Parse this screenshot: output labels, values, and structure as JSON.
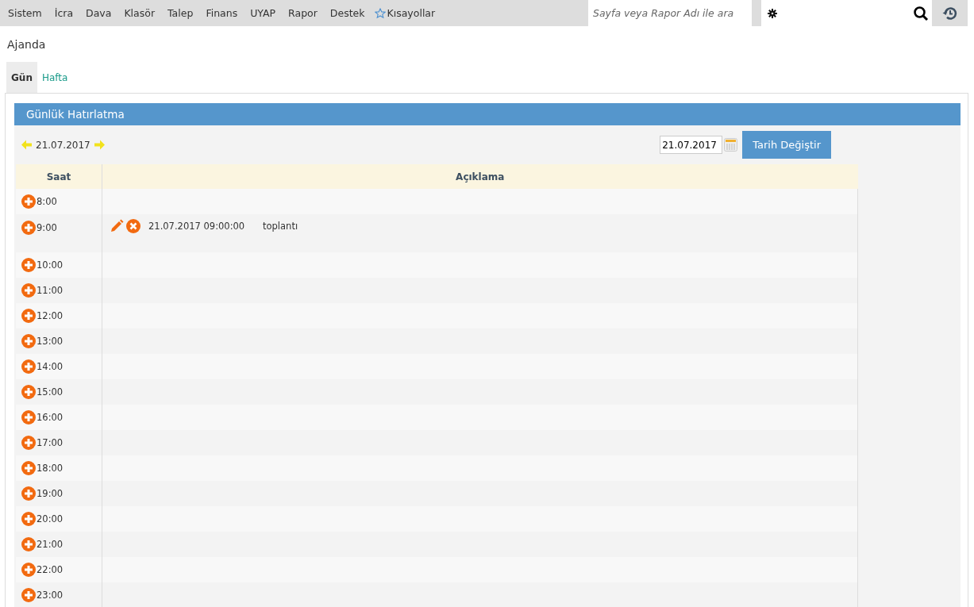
{
  "menu": [
    {
      "label": "Sistem"
    },
    {
      "label": "İcra"
    },
    {
      "label": "Dava"
    },
    {
      "label": "Klasör"
    },
    {
      "label": "Talep"
    },
    {
      "label": "Finans"
    },
    {
      "label": "UYAP"
    },
    {
      "label": "Rapor"
    },
    {
      "label": "Destek"
    }
  ],
  "shortcuts": {
    "label": "Kısayollar"
  },
  "search": {
    "placeholder": "Sayfa veya Rapor Adı ile ara"
  },
  "page_title": "Ajanda",
  "tabs": [
    {
      "label": "Gün",
      "selected": true
    },
    {
      "label": "Hafta",
      "selected": false
    }
  ],
  "panel": {
    "title": "Günlük Hatırlatma",
    "current_date": "21.07.2017",
    "date_field": {
      "value": "21.07.2017"
    },
    "change_button": "Tarih Değiştir",
    "columns": [
      "Saat",
      "Açıklama"
    ],
    "rows": [
      {
        "time": "8:00",
        "entries": []
      },
      {
        "time": "9:00",
        "entries": [
          {
            "datetime": "21.07.2017 09:00:00",
            "description": "toplantı"
          }
        ]
      },
      {
        "time": "10:00",
        "entries": []
      },
      {
        "time": "11:00",
        "entries": []
      },
      {
        "time": "12:00",
        "entries": []
      },
      {
        "time": "13:00",
        "entries": []
      },
      {
        "time": "14:00",
        "entries": []
      },
      {
        "time": "15:00",
        "entries": []
      },
      {
        "time": "16:00",
        "entries": []
      },
      {
        "time": "17:00",
        "entries": []
      },
      {
        "time": "18:00",
        "entries": []
      },
      {
        "time": "19:00",
        "entries": []
      },
      {
        "time": "20:00",
        "entries": []
      },
      {
        "time": "21:00",
        "entries": []
      },
      {
        "time": "22:00",
        "entries": []
      },
      {
        "time": "23:00",
        "entries": []
      }
    ]
  }
}
